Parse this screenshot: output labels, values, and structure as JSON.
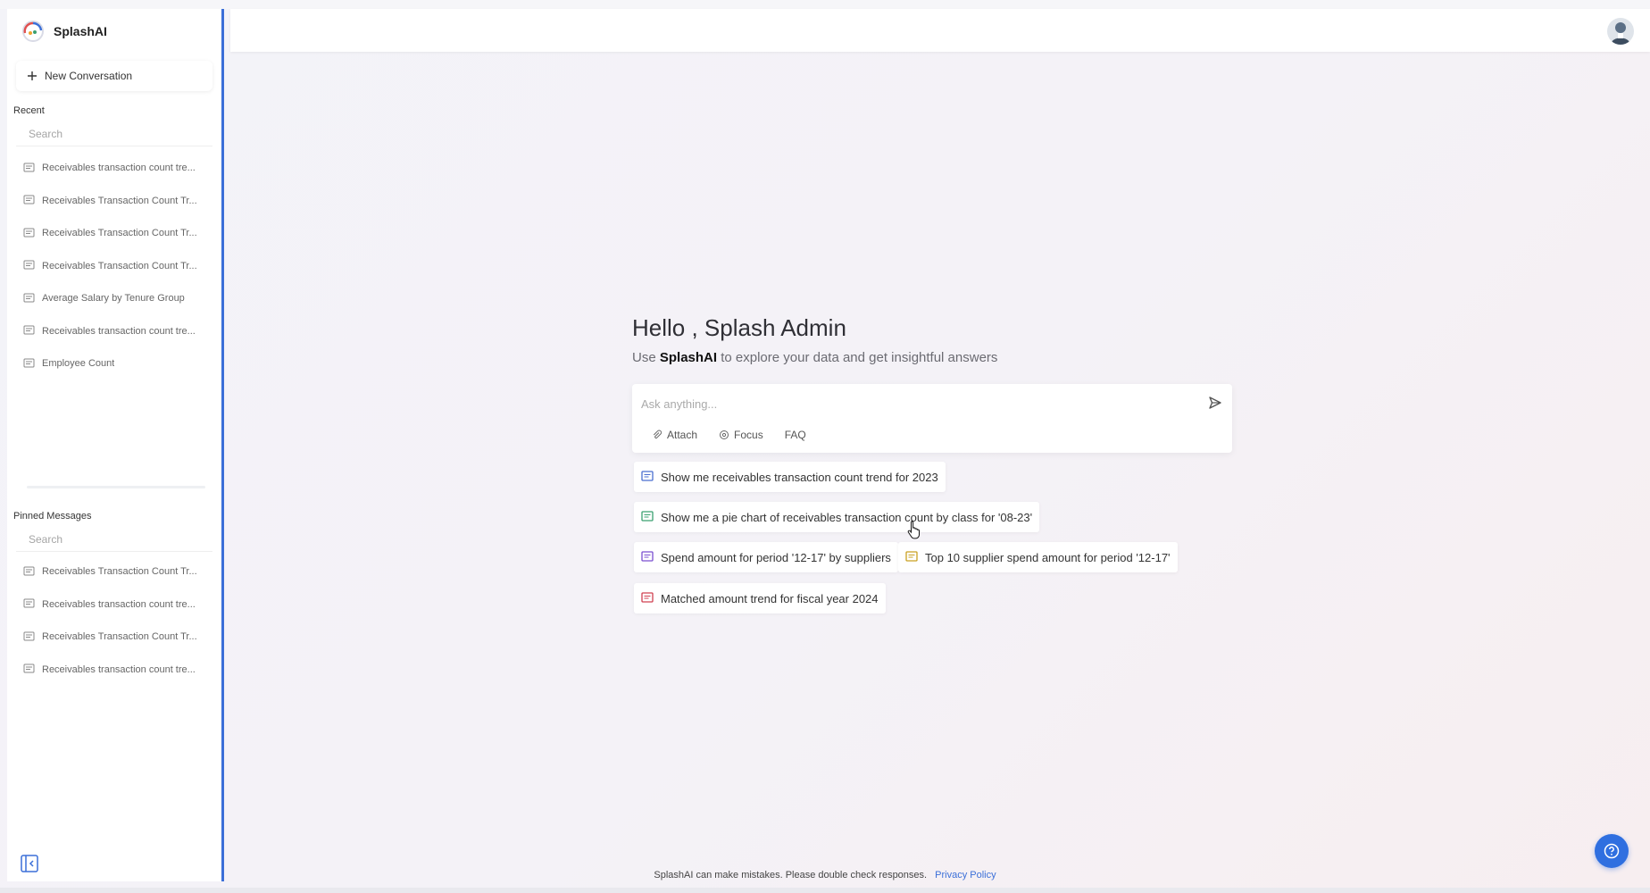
{
  "app": {
    "name": "SplashAI"
  },
  "sidebar": {
    "new_conversation": "New Conversation",
    "recent_title": "Recent",
    "recent_search_placeholder": "Search",
    "recent_items": [
      {
        "label": "Receivables transaction count tre..."
      },
      {
        "label": "Receivables Transaction Count Tr..."
      },
      {
        "label": "Receivables Transaction Count Tr..."
      },
      {
        "label": "Receivables Transaction Count Tr..."
      },
      {
        "label": "Average Salary by Tenure Group"
      },
      {
        "label": "Receivables transaction count tre..."
      },
      {
        "label": "Employee Count"
      }
    ],
    "pinned_title": "Pinned Messages",
    "pinned_search_placeholder": "Search",
    "pinned_items": [
      {
        "label": "Receivables Transaction Count Tr..."
      },
      {
        "label": "Receivables transaction count tre..."
      },
      {
        "label": "Receivables Transaction Count Tr..."
      },
      {
        "label": "Receivables transaction count tre..."
      }
    ]
  },
  "main": {
    "greeting": "Hello , Splash Admin",
    "sub_prefix": "Use",
    "sub_brand": "SplashAI",
    "sub_suffix": "to explore your data and get insightful answers",
    "ask_placeholder": "Ask anything...",
    "chips": {
      "attach": "Attach",
      "focus": "Focus",
      "faq": "FAQ"
    },
    "suggestions": [
      {
        "label": "Show me receivables transaction count trend for 2023",
        "color": "#4a6fd0"
      },
      {
        "label": "Show me a pie chart of receivables transaction count by class for '08-23'",
        "color": "#3aa070"
      },
      {
        "label": "Spend amount for period '12-17' by suppliers",
        "color": "#7a4fd0"
      },
      {
        "label": "Top 10 supplier spend amount for period '12-17'",
        "color": "#c9a020"
      },
      {
        "label": "Matched amount trend for fiscal year 2024",
        "color": "#d04050"
      }
    ]
  },
  "footer": {
    "disclaimer": "SplashAI can make mistakes. Please double check responses.",
    "privacy": "Privacy Policy"
  },
  "colors": {
    "accent": "#3b6fd8",
    "help_button": "#2f6fe0"
  }
}
